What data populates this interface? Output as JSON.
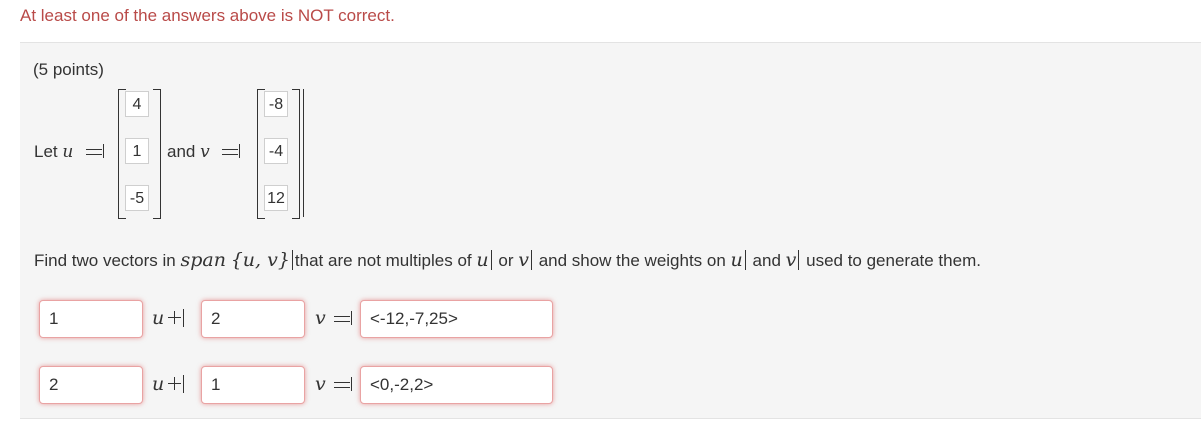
{
  "alert": {
    "text": "At least one of the answers above is NOT correct."
  },
  "question": {
    "points": "(5 points)",
    "let_label": "Let",
    "u_symbol": "u",
    "and_label": "and",
    "v_symbol": "v",
    "u_vector": [
      "4",
      "1",
      "-5"
    ],
    "v_vector": [
      "-8",
      "-4",
      "12"
    ],
    "instruction_prefix": "Find two vectors in",
    "span_word": "span",
    "span_set": "{u, v}",
    "instruction_middle": "that are not multiples of",
    "u_ref": "u",
    "or_word": "or",
    "v_ref": "v",
    "instruction_end_1": "and show the weights on",
    "u_ref2": "u",
    "and_word": "and",
    "v_ref2": "v",
    "instruction_end_2": "used to generate them."
  },
  "answers": [
    {
      "weight_u": "1",
      "u_symbol": "u",
      "weight_v": "2",
      "v_symbol": "v",
      "result": "<-12,-7,25>"
    },
    {
      "weight_u": "2",
      "u_symbol": "u",
      "weight_v": "1",
      "v_symbol": "v",
      "result": "<0,-2,2>"
    }
  ]
}
